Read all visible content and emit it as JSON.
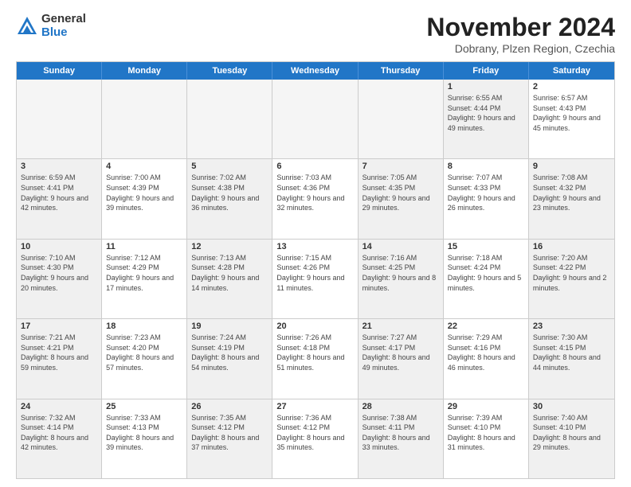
{
  "logo": {
    "general": "General",
    "blue": "Blue"
  },
  "title": "November 2024",
  "subtitle": "Dobrany, Plzen Region, Czechia",
  "weekdays": [
    "Sunday",
    "Monday",
    "Tuesday",
    "Wednesday",
    "Thursday",
    "Friday",
    "Saturday"
  ],
  "rows": [
    [
      {
        "day": "",
        "info": "",
        "empty": true
      },
      {
        "day": "",
        "info": "",
        "empty": true
      },
      {
        "day": "",
        "info": "",
        "empty": true
      },
      {
        "day": "",
        "info": "",
        "empty": true
      },
      {
        "day": "",
        "info": "",
        "empty": true
      },
      {
        "day": "1",
        "info": "Sunrise: 6:55 AM\nSunset: 4:44 PM\nDaylight: 9 hours and 49 minutes.",
        "shaded": true
      },
      {
        "day": "2",
        "info": "Sunrise: 6:57 AM\nSunset: 4:43 PM\nDaylight: 9 hours and 45 minutes.",
        "shaded": false
      }
    ],
    [
      {
        "day": "3",
        "info": "Sunrise: 6:59 AM\nSunset: 4:41 PM\nDaylight: 9 hours and 42 minutes.",
        "shaded": true
      },
      {
        "day": "4",
        "info": "Sunrise: 7:00 AM\nSunset: 4:39 PM\nDaylight: 9 hours and 39 minutes.",
        "shaded": false
      },
      {
        "day": "5",
        "info": "Sunrise: 7:02 AM\nSunset: 4:38 PM\nDaylight: 9 hours and 36 minutes.",
        "shaded": true
      },
      {
        "day": "6",
        "info": "Sunrise: 7:03 AM\nSunset: 4:36 PM\nDaylight: 9 hours and 32 minutes.",
        "shaded": false
      },
      {
        "day": "7",
        "info": "Sunrise: 7:05 AM\nSunset: 4:35 PM\nDaylight: 9 hours and 29 minutes.",
        "shaded": true
      },
      {
        "day": "8",
        "info": "Sunrise: 7:07 AM\nSunset: 4:33 PM\nDaylight: 9 hours and 26 minutes.",
        "shaded": false
      },
      {
        "day": "9",
        "info": "Sunrise: 7:08 AM\nSunset: 4:32 PM\nDaylight: 9 hours and 23 minutes.",
        "shaded": true
      }
    ],
    [
      {
        "day": "10",
        "info": "Sunrise: 7:10 AM\nSunset: 4:30 PM\nDaylight: 9 hours and 20 minutes.",
        "shaded": true
      },
      {
        "day": "11",
        "info": "Sunrise: 7:12 AM\nSunset: 4:29 PM\nDaylight: 9 hours and 17 minutes.",
        "shaded": false
      },
      {
        "day": "12",
        "info": "Sunrise: 7:13 AM\nSunset: 4:28 PM\nDaylight: 9 hours and 14 minutes.",
        "shaded": true
      },
      {
        "day": "13",
        "info": "Sunrise: 7:15 AM\nSunset: 4:26 PM\nDaylight: 9 hours and 11 minutes.",
        "shaded": false
      },
      {
        "day": "14",
        "info": "Sunrise: 7:16 AM\nSunset: 4:25 PM\nDaylight: 9 hours and 8 minutes.",
        "shaded": true
      },
      {
        "day": "15",
        "info": "Sunrise: 7:18 AM\nSunset: 4:24 PM\nDaylight: 9 hours and 5 minutes.",
        "shaded": false
      },
      {
        "day": "16",
        "info": "Sunrise: 7:20 AM\nSunset: 4:22 PM\nDaylight: 9 hours and 2 minutes.",
        "shaded": true
      }
    ],
    [
      {
        "day": "17",
        "info": "Sunrise: 7:21 AM\nSunset: 4:21 PM\nDaylight: 8 hours and 59 minutes.",
        "shaded": true
      },
      {
        "day": "18",
        "info": "Sunrise: 7:23 AM\nSunset: 4:20 PM\nDaylight: 8 hours and 57 minutes.",
        "shaded": false
      },
      {
        "day": "19",
        "info": "Sunrise: 7:24 AM\nSunset: 4:19 PM\nDaylight: 8 hours and 54 minutes.",
        "shaded": true
      },
      {
        "day": "20",
        "info": "Sunrise: 7:26 AM\nSunset: 4:18 PM\nDaylight: 8 hours and 51 minutes.",
        "shaded": false
      },
      {
        "day": "21",
        "info": "Sunrise: 7:27 AM\nSunset: 4:17 PM\nDaylight: 8 hours and 49 minutes.",
        "shaded": true
      },
      {
        "day": "22",
        "info": "Sunrise: 7:29 AM\nSunset: 4:16 PM\nDaylight: 8 hours and 46 minutes.",
        "shaded": false
      },
      {
        "day": "23",
        "info": "Sunrise: 7:30 AM\nSunset: 4:15 PM\nDaylight: 8 hours and 44 minutes.",
        "shaded": true
      }
    ],
    [
      {
        "day": "24",
        "info": "Sunrise: 7:32 AM\nSunset: 4:14 PM\nDaylight: 8 hours and 42 minutes.",
        "shaded": true
      },
      {
        "day": "25",
        "info": "Sunrise: 7:33 AM\nSunset: 4:13 PM\nDaylight: 8 hours and 39 minutes.",
        "shaded": false
      },
      {
        "day": "26",
        "info": "Sunrise: 7:35 AM\nSunset: 4:12 PM\nDaylight: 8 hours and 37 minutes.",
        "shaded": true
      },
      {
        "day": "27",
        "info": "Sunrise: 7:36 AM\nSunset: 4:12 PM\nDaylight: 8 hours and 35 minutes.",
        "shaded": false
      },
      {
        "day": "28",
        "info": "Sunrise: 7:38 AM\nSunset: 4:11 PM\nDaylight: 8 hours and 33 minutes.",
        "shaded": true
      },
      {
        "day": "29",
        "info": "Sunrise: 7:39 AM\nSunset: 4:10 PM\nDaylight: 8 hours and 31 minutes.",
        "shaded": false
      },
      {
        "day": "30",
        "info": "Sunrise: 7:40 AM\nSunset: 4:10 PM\nDaylight: 8 hours and 29 minutes.",
        "shaded": true
      }
    ]
  ]
}
